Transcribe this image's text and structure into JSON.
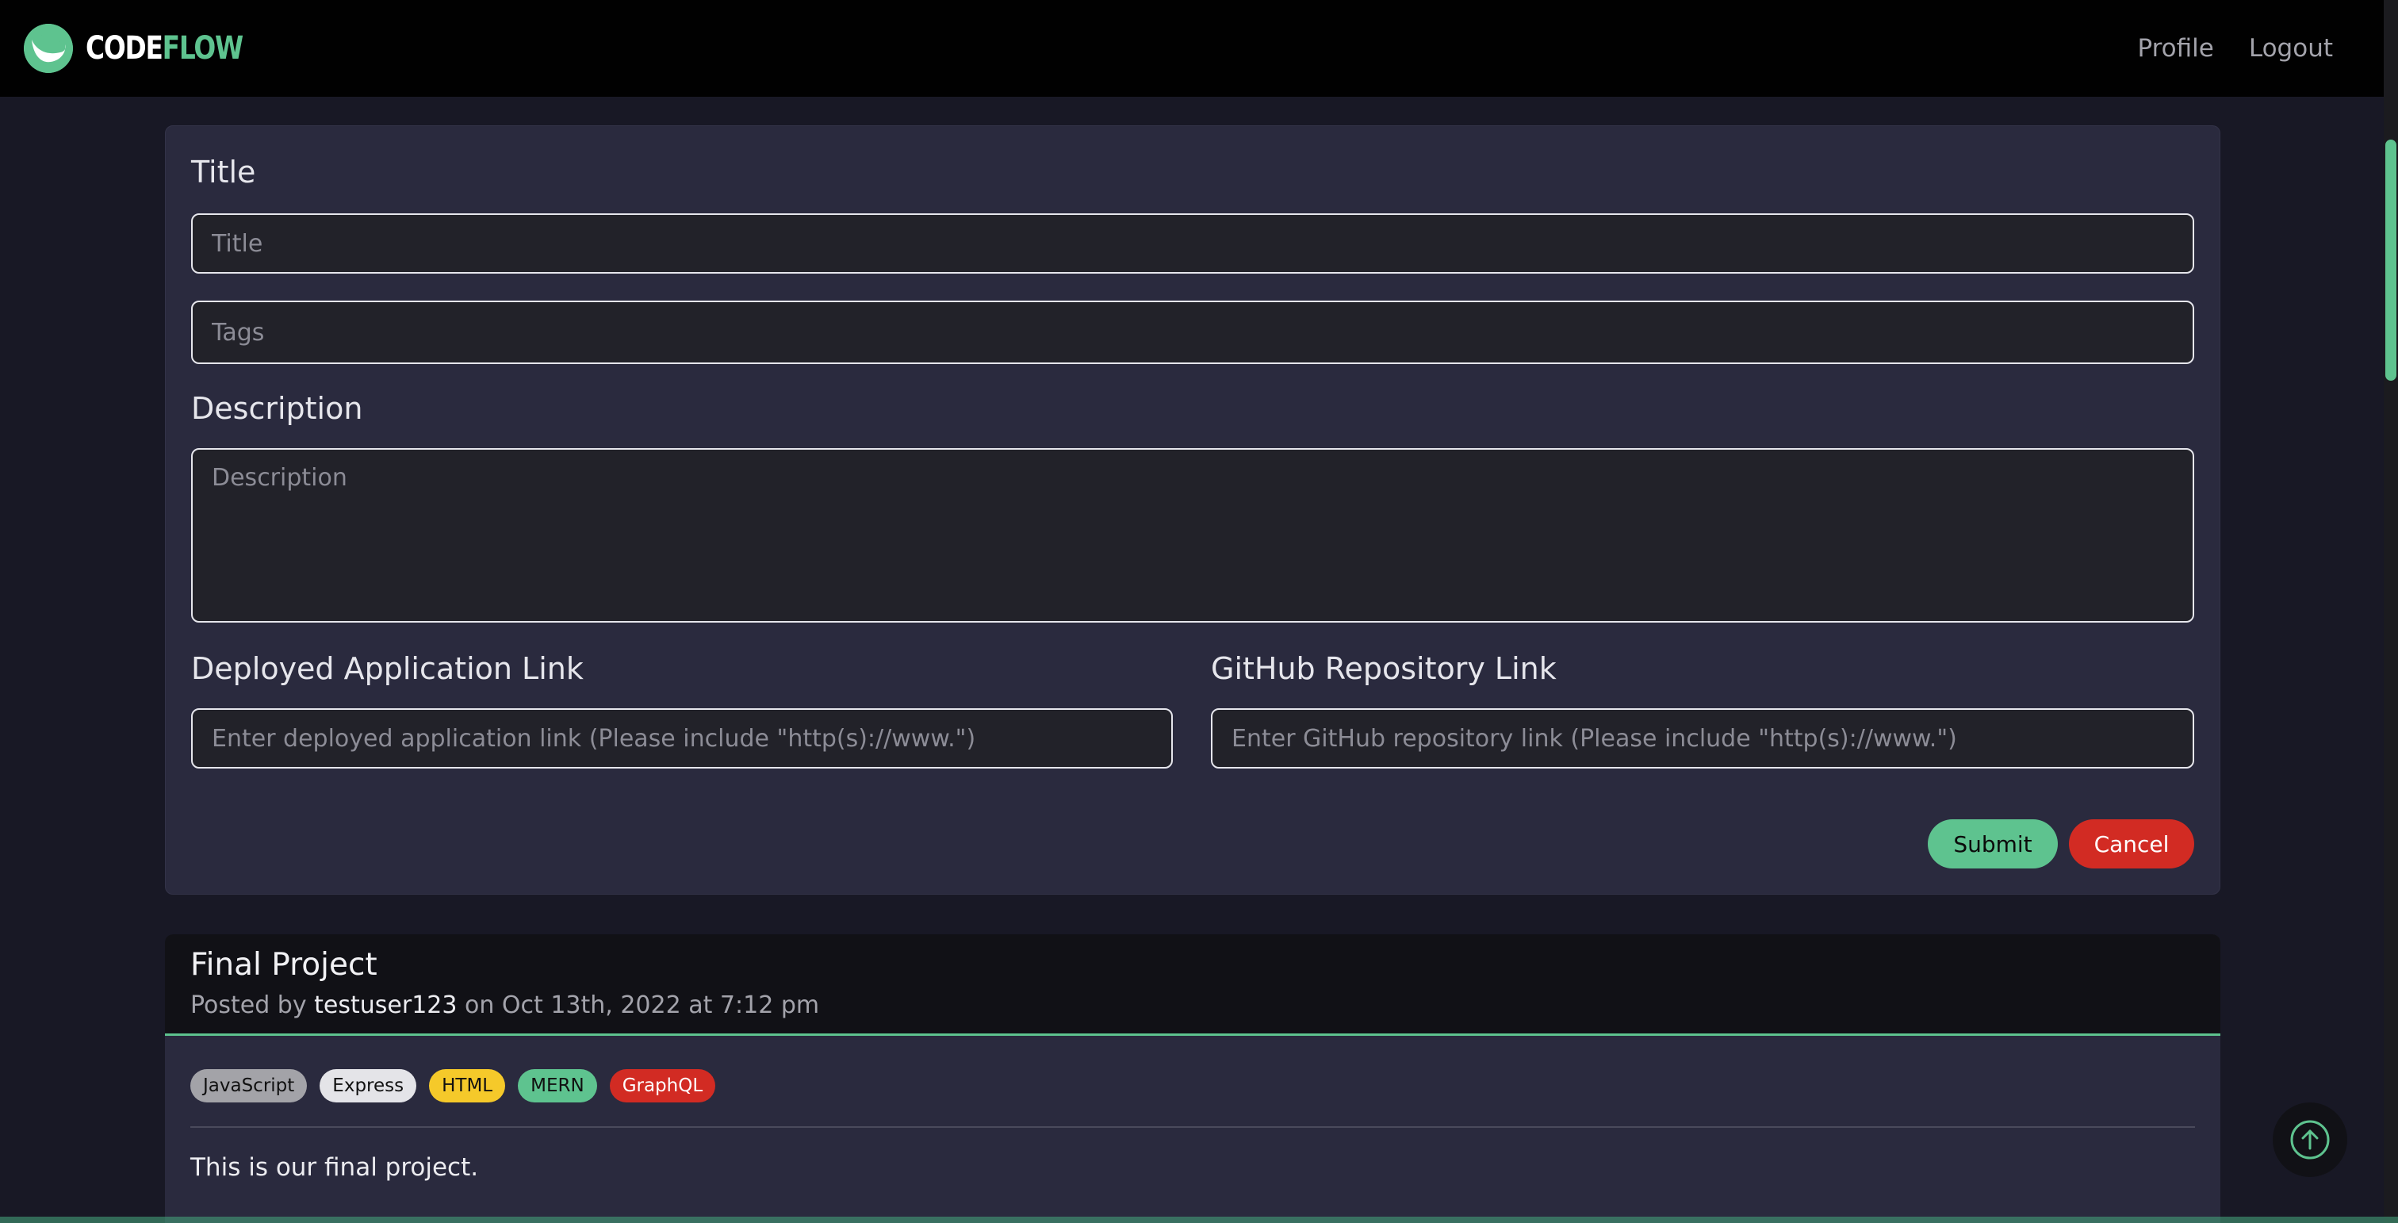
{
  "brand": {
    "name_part1": "CODE",
    "name_part2": "FLOW"
  },
  "nav": {
    "profile": "Profile",
    "logout": "Logout"
  },
  "form": {
    "title_label": "Title",
    "title_placeholder": "Title",
    "tags_placeholder": "Tags",
    "description_label": "Description",
    "description_placeholder": "Description",
    "deployed_label": "Deployed Application Link",
    "deployed_placeholder": "Enter deployed application link (Please include \"http(s)://www.\")",
    "github_label": "GitHub Repository Link",
    "github_placeholder": "Enter GitHub repository link (Please include \"http(s)://www.\")",
    "submit_label": "Submit",
    "cancel_label": "Cancel"
  },
  "post": {
    "title": "Final Project",
    "posted_by_prefix": "Posted by",
    "username": "testuser123",
    "date_text": "on Oct 13th, 2022 at 7:12 pm",
    "tags": [
      {
        "label": "JavaScript",
        "bg": "#a3a3a8",
        "fg": "#111111"
      },
      {
        "label": "Express",
        "bg": "#e4e4e8",
        "fg": "#111111"
      },
      {
        "label": "HTML",
        "bg": "#f5c92a",
        "fg": "#111111"
      },
      {
        "label": "MERN",
        "bg": "#5ec38f",
        "fg": "#111111"
      },
      {
        "label": "GraphQL",
        "bg": "#d22b23",
        "fg": "#ffffff"
      }
    ],
    "body": "This is our final project."
  },
  "colors": {
    "accent": "#5ec38f",
    "danger": "#d22b23",
    "card": "#2a2a3e",
    "header": "#010101"
  },
  "icons": {
    "back_to_top": "arrow-up-circle-icon",
    "logo": "codeflow-logo-icon"
  }
}
